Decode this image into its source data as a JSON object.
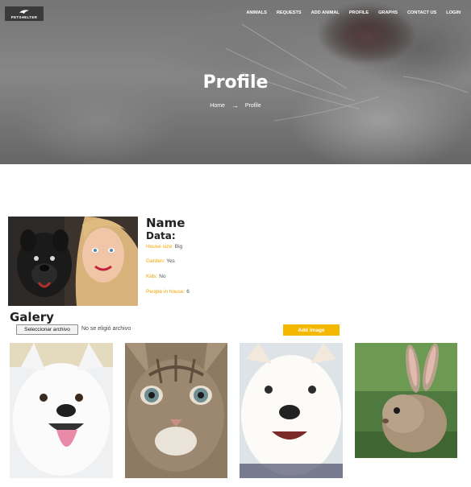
{
  "brand": {
    "logo_text": "PETSHELTER"
  },
  "nav": {
    "items": [
      "ANIMALS",
      "REQUESTS",
      "ADD ANIMAL",
      "PROFILE",
      "GRAPHS",
      "CONTACT US",
      "LOGIN"
    ]
  },
  "hero": {
    "title": "Profile",
    "breadcrumb_home": "Home",
    "breadcrumb_arrow": "→",
    "breadcrumb_current": "Profile"
  },
  "profile": {
    "name": "Name",
    "data_title": "Data:",
    "fields": [
      {
        "label": "House size:",
        "value": "Big"
      },
      {
        "label": "Garden:",
        "value": "Yes"
      },
      {
        "label": "Kids:",
        "value": "No"
      },
      {
        "label": "People in house:",
        "value": "6"
      }
    ]
  },
  "gallery": {
    "title": "Galery",
    "file_button": "Seleccionar archivo",
    "file_status": "No se eligió archivo",
    "add_button": "Add image",
    "images": [
      "white puppy",
      "tabby kitten",
      "fluffy puppy",
      "rabbit"
    ]
  },
  "colors": {
    "accent": "#f5b800",
    "label": "#f0a500"
  }
}
